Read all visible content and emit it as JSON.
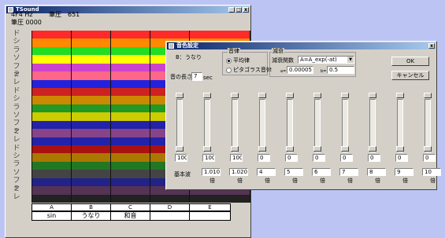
{
  "main_window": {
    "title": "TSound",
    "freq": "4F4 Hz",
    "pressure_top": "筆圧",
    "pressure_top_value": "651",
    "pressure_bottom": "筆圧 0000",
    "note_labels": [
      "ド",
      "シ",
      "ラ",
      "ソ",
      "ファ",
      "ミ",
      "レ",
      "ド",
      "シ",
      "ラ",
      "ソ",
      "ファ",
      "ミ",
      "レ",
      "ド",
      "シ",
      "ラ",
      "ソ",
      "ファ",
      "ミ",
      "レ"
    ],
    "stripe_colors": [
      "#ff2a2a",
      "#ff8a00",
      "#22dd22",
      "#ffff00",
      "#cc44cc",
      "#ff6688",
      "#2222dd",
      "#cc2222",
      "#cc8800",
      "#229922",
      "#cccc00",
      "#2222aa",
      "#884488",
      "#2222aa",
      "#aa1111",
      "#aa7700",
      "#227722",
      "#444444",
      "#222288",
      "#553355",
      "#222222"
    ],
    "columns": [
      {
        "head": "A",
        "value": "sin"
      },
      {
        "head": "B",
        "value": "うなり"
      },
      {
        "head": "C",
        "value": "和音"
      },
      {
        "head": "D",
        "value": ""
      },
      {
        "head": "E",
        "value": ""
      }
    ]
  },
  "dialog": {
    "title": "音色設定",
    "tone_label": "B：",
    "tone_value": "うなり",
    "length_label": "音の長さ",
    "length_value": "7",
    "length_unit": "sec",
    "temperament_group": "音律",
    "temperament_options": [
      {
        "label": "平均律",
        "selected": true
      },
      {
        "label": "ピタゴラス音律",
        "selected": false
      }
    ],
    "decay_group": "減衰",
    "decay_func_label": "減衰関数",
    "decay_func_value": "A=A_exp(-at)",
    "a_label": "a=",
    "a_value": "0.00005",
    "b_label": "b=",
    "b_value": "0.5",
    "ok_label": "OK",
    "cancel_label": "キャンセル",
    "slider_values": [
      "100",
      "100",
      "100",
      "0",
      "0",
      "0",
      "0",
      "0",
      "0",
      "0"
    ],
    "slider_levels": [
      1,
      1,
      1,
      0,
      0,
      0,
      0,
      0,
      0,
      0
    ],
    "base_label": "基本波",
    "multipliers": [
      "1.0100",
      "1.0200",
      "4",
      "5",
      "6",
      "7",
      "8",
      "9",
      "10"
    ],
    "mult_unit": "倍"
  }
}
